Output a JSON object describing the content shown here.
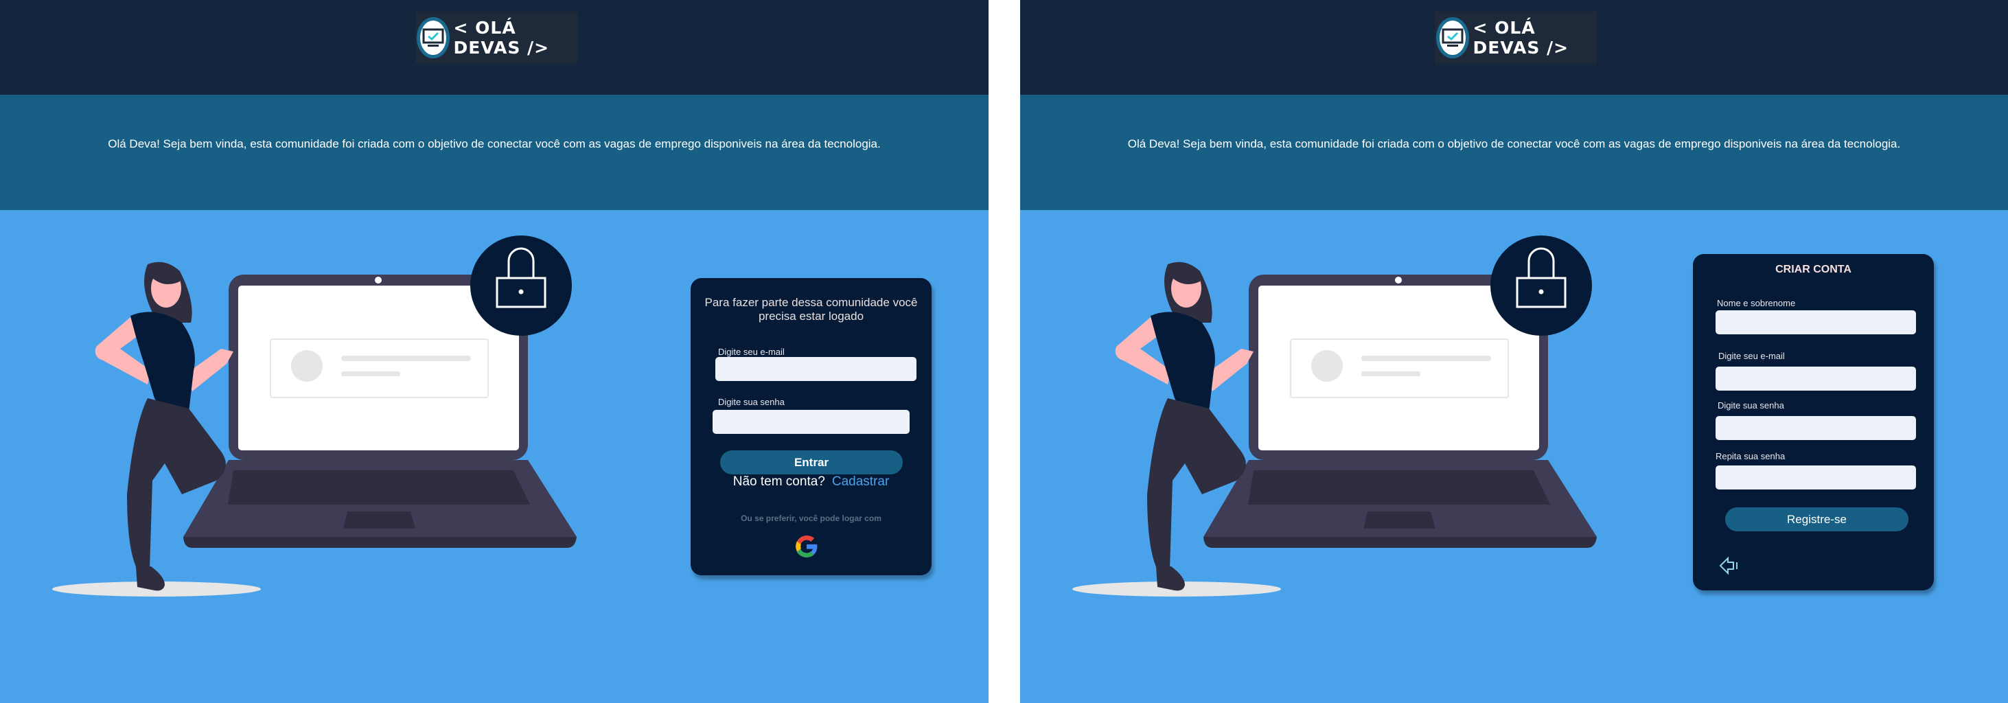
{
  "header": {
    "logo_text": "< OLÁ DEVAS />",
    "logo_icon": "monitor-check-icon"
  },
  "welcome_text": "Olá Deva! Seja bem vinda, esta comunidade foi criada com o objetivo de conectar você com as vagas de emprego disponiveis na área da tecnologia.",
  "colors": {
    "header": "#14263d",
    "band": "#175f85",
    "background": "#4aa3ea",
    "card": "#051a36",
    "button": "#175f85",
    "link": "#4aa3ea"
  },
  "login": {
    "lead": "Para fazer parte dessa comunidade você precisa estar logado",
    "email_label": "Digite seu e-mail",
    "email_value": "",
    "password_label": "Digite sua senha",
    "password_value": "",
    "submit": "Entrar",
    "no_account": "Não tem conta?",
    "register_link": "Cadastrar",
    "alt_login": "Ou se preferir, você pode logar com",
    "alt_icon": "google-icon"
  },
  "signup": {
    "title": "CRIAR CONTA",
    "name_label": "Nome e sobrenome",
    "email_label": "Digite seu e-mail",
    "password_label": "Digite sua senha",
    "repeat_label": "Repita sua senha",
    "submit": "Registre-se",
    "back_icon": "back-arrow-icon"
  }
}
